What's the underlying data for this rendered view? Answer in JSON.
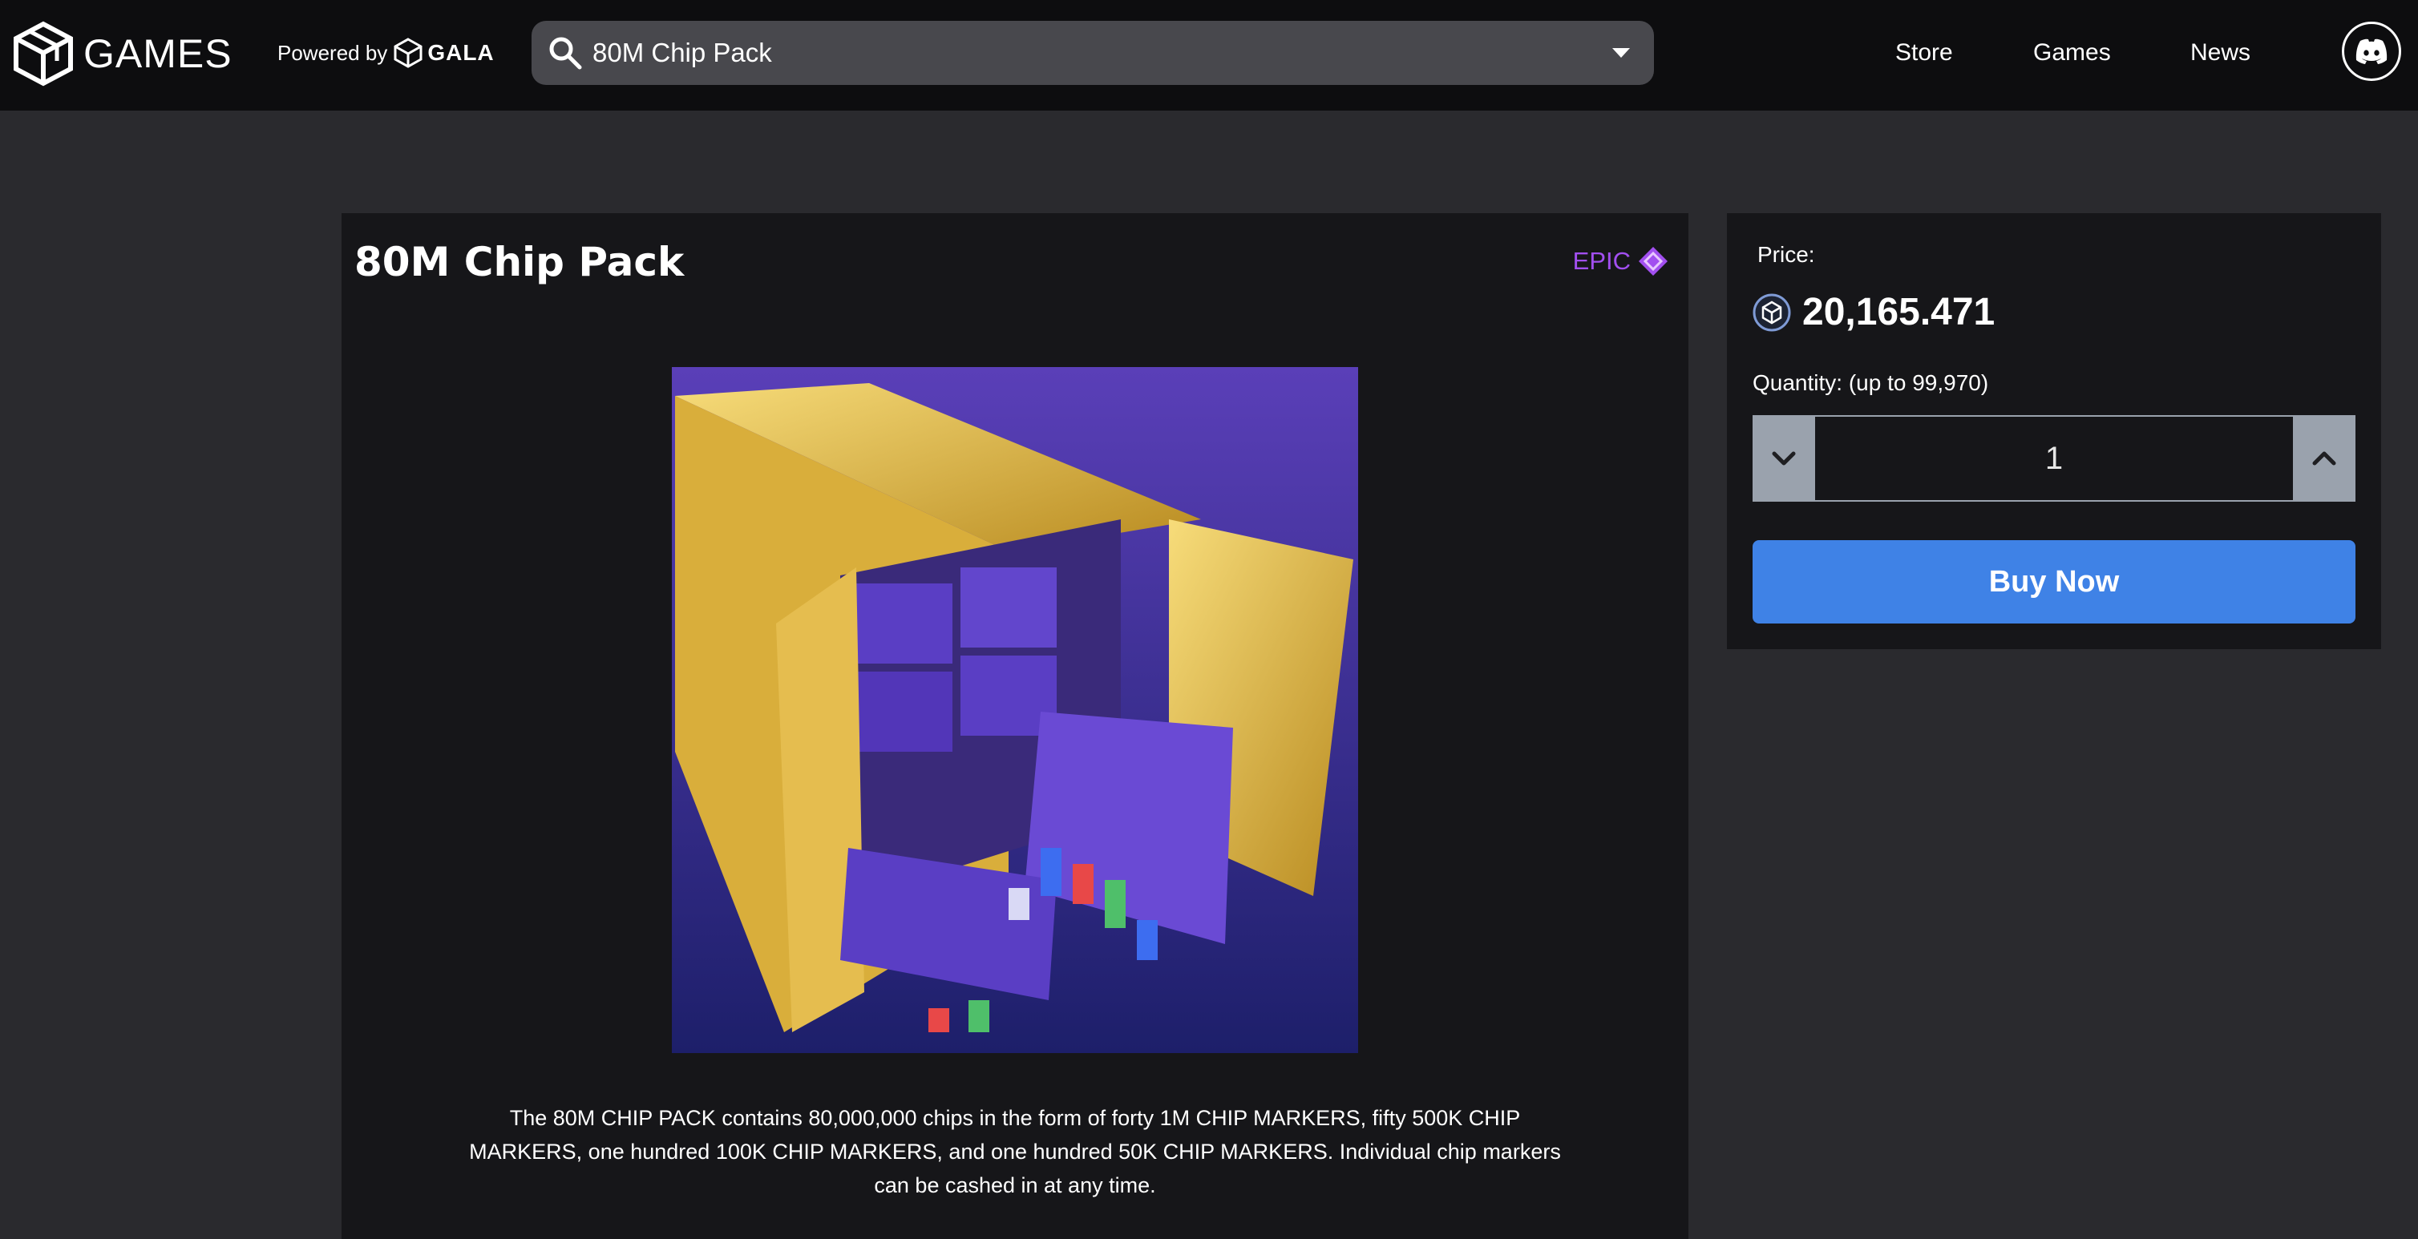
{
  "header": {
    "logo_text": "GAMES",
    "powered_by_label": "Powered by",
    "powered_by_brand": "GALA",
    "search": {
      "value": "80M Chip Pack"
    },
    "nav": [
      {
        "label": "Store"
      },
      {
        "label": "Games"
      },
      {
        "label": "News"
      }
    ],
    "discord_icon": "discord-icon"
  },
  "product": {
    "title": "80M Chip Pack",
    "rarity": "EPIC",
    "rarity_color": "#a24ff0",
    "image_alt": "Gold shipping container filled with purple Poker Go chip crates and stacks of chips",
    "description": "The 80M CHIP PACK contains 80,000,000 chips in the form of forty 1M CHIP MARKERS, fifty 500K CHIP MARKERS, one hundred 100K CHIP MARKERS, and one hundred 50K CHIP MARKERS. Individual chip markers can be cashed in at any time."
  },
  "purchase": {
    "price_label": "Price:",
    "price_value": "20,165.471",
    "quantity_label": "Quantity: (up to 99,970)",
    "quantity_value": "1",
    "buy_label": "Buy Now",
    "buy_color": "#3f82e6"
  },
  "colors": {
    "background": "#2a2a2e",
    "header": "#0d0d0f",
    "panel": "#161619",
    "search": "#48484d"
  }
}
